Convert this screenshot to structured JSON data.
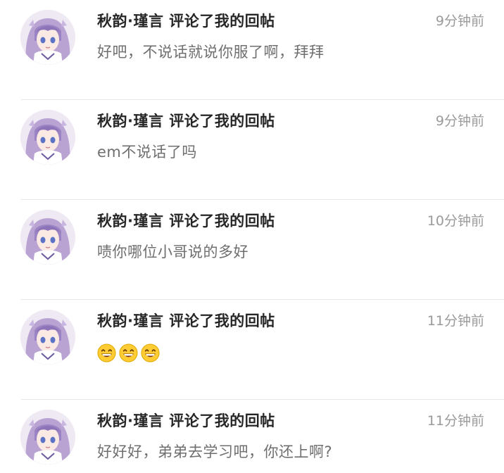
{
  "notifications": [
    {
      "avatar": "anime-girl-avatar",
      "title": "秋韵·瑾言 评论了我的回帖",
      "time": "9分钟前",
      "content": "好吧，不说话就说你服了啊，拜拜"
    },
    {
      "avatar": "anime-girl-avatar",
      "title": "秋韵·瑾言 评论了我的回帖",
      "time": "9分钟前",
      "content": "em不说话了吗"
    },
    {
      "avatar": "anime-girl-avatar",
      "title": "秋韵·瑾言 评论了我的回帖",
      "time": "10分钟前",
      "content": "啧你哪位小哥说的多好"
    },
    {
      "avatar": "anime-girl-avatar",
      "title": "秋韵·瑾言 评论了我的回帖",
      "time": "11分钟前",
      "content": "",
      "emoji": [
        "grinning-face-icon",
        "grinning-face-icon",
        "grinning-face-icon"
      ]
    },
    {
      "avatar": "anime-girl-avatar",
      "title": "秋韵·瑾言 评论了我的回帖",
      "time": "11分钟前",
      "content": "好好好，弟弟去学习吧，你还上啊?"
    }
  ]
}
